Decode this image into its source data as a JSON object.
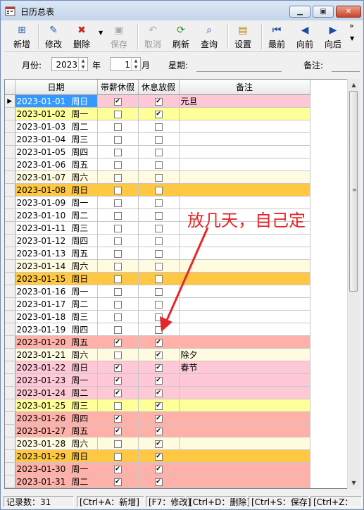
{
  "window": {
    "title": "日历总表"
  },
  "toolbar": [
    {
      "label": "新增",
      "icon": "add-icon",
      "enabled": true
    },
    {
      "label": "修改",
      "icon": "edit-icon",
      "enabled": true
    },
    {
      "label": "删除",
      "icon": "delete-icon",
      "enabled": true
    },
    {
      "label": "保存",
      "icon": "save-icon",
      "enabled": false
    },
    {
      "label": "取消",
      "icon": "undo-icon",
      "enabled": false
    },
    {
      "label": "刷新",
      "icon": "refresh-icon",
      "enabled": true
    },
    {
      "label": "查询",
      "icon": "search-icon",
      "enabled": true
    },
    {
      "label": "设置",
      "icon": "settings-icon",
      "enabled": true
    },
    {
      "label": "最前",
      "icon": "first-icon",
      "enabled": true
    },
    {
      "label": "向前",
      "icon": "prev-icon",
      "enabled": true
    },
    {
      "label": "向后",
      "icon": "next-icon",
      "enabled": true
    }
  ],
  "filter": {
    "month_label": "月份:",
    "year_value": "2023",
    "year_unit": "年",
    "month_value": "1",
    "month_unit": "月",
    "weekday_label": "星期:",
    "note_label": "备注:"
  },
  "grid": {
    "columns": [
      "日期",
      "带薪休假",
      "休息放假",
      "备注"
    ],
    "rows": [
      {
        "date": "2023-01-01",
        "weekday": "周日",
        "paid": true,
        "rest": true,
        "note": "元旦",
        "bg": "#ffc8d6",
        "selected": true
      },
      {
        "date": "2023-01-02",
        "weekday": "周一",
        "paid": false,
        "rest": true,
        "note": "",
        "bg": "#ffff99"
      },
      {
        "date": "2023-01-03",
        "weekday": "周二",
        "paid": false,
        "rest": false,
        "note": "",
        "bg": "#ffffff"
      },
      {
        "date": "2023-01-04",
        "weekday": "周三",
        "paid": false,
        "rest": false,
        "note": "",
        "bg": "#ffffff"
      },
      {
        "date": "2023-01-05",
        "weekday": "周四",
        "paid": false,
        "rest": false,
        "note": "",
        "bg": "#ffffff"
      },
      {
        "date": "2023-01-06",
        "weekday": "周五",
        "paid": false,
        "rest": false,
        "note": "",
        "bg": "#ffffff"
      },
      {
        "date": "2023-01-07",
        "weekday": "周六",
        "paid": false,
        "rest": false,
        "note": "",
        "bg": "#fffbe0"
      },
      {
        "date": "2023-01-08",
        "weekday": "周日",
        "paid": false,
        "rest": false,
        "note": "",
        "bg": "#ffc844"
      },
      {
        "date": "2023-01-09",
        "weekday": "周一",
        "paid": false,
        "rest": false,
        "note": "",
        "bg": "#ffffff"
      },
      {
        "date": "2023-01-10",
        "weekday": "周二",
        "paid": false,
        "rest": false,
        "note": "",
        "bg": "#ffffff"
      },
      {
        "date": "2023-01-11",
        "weekday": "周三",
        "paid": false,
        "rest": false,
        "note": "",
        "bg": "#ffffff"
      },
      {
        "date": "2023-01-12",
        "weekday": "周四",
        "paid": false,
        "rest": false,
        "note": "",
        "bg": "#ffffff"
      },
      {
        "date": "2023-01-13",
        "weekday": "周五",
        "paid": false,
        "rest": false,
        "note": "",
        "bg": "#ffffff"
      },
      {
        "date": "2023-01-14",
        "weekday": "周六",
        "paid": false,
        "rest": false,
        "note": "",
        "bg": "#fffbe0"
      },
      {
        "date": "2023-01-15",
        "weekday": "周日",
        "paid": false,
        "rest": false,
        "note": "",
        "bg": "#ffc844"
      },
      {
        "date": "2023-01-16",
        "weekday": "周一",
        "paid": false,
        "rest": false,
        "note": "",
        "bg": "#ffffff"
      },
      {
        "date": "2023-01-17",
        "weekday": "周二",
        "paid": false,
        "rest": false,
        "note": "",
        "bg": "#ffffff"
      },
      {
        "date": "2023-01-18",
        "weekday": "周三",
        "paid": false,
        "rest": false,
        "note": "",
        "bg": "#ffffff"
      },
      {
        "date": "2023-01-19",
        "weekday": "周四",
        "paid": false,
        "rest": false,
        "note": "",
        "bg": "#ffffff"
      },
      {
        "date": "2023-01-20",
        "weekday": "周五",
        "paid": true,
        "rest": true,
        "note": "",
        "bg": "#ffb0a8"
      },
      {
        "date": "2023-01-21",
        "weekday": "周六",
        "paid": false,
        "rest": true,
        "note": "除夕",
        "bg": "#fffbe0"
      },
      {
        "date": "2023-01-22",
        "weekday": "周日",
        "paid": true,
        "rest": true,
        "note": "春节",
        "bg": "#ffc8d6"
      },
      {
        "date": "2023-01-23",
        "weekday": "周一",
        "paid": true,
        "rest": true,
        "note": "",
        "bg": "#ffc8d6"
      },
      {
        "date": "2023-01-24",
        "weekday": "周二",
        "paid": true,
        "rest": true,
        "note": "",
        "bg": "#ffc8d6"
      },
      {
        "date": "2023-01-25",
        "weekday": "周三",
        "paid": false,
        "rest": true,
        "note": "",
        "bg": "#ffff99"
      },
      {
        "date": "2023-01-26",
        "weekday": "周四",
        "paid": true,
        "rest": true,
        "note": "",
        "bg": "#ffb0a8"
      },
      {
        "date": "2023-01-27",
        "weekday": "周五",
        "paid": true,
        "rest": true,
        "note": "",
        "bg": "#ffb0a8"
      },
      {
        "date": "2023-01-28",
        "weekday": "周六",
        "paid": false,
        "rest": true,
        "note": "",
        "bg": "#fffbe0"
      },
      {
        "date": "2023-01-29",
        "weekday": "周日",
        "paid": false,
        "rest": true,
        "note": "",
        "bg": "#ffc844"
      },
      {
        "date": "2023-01-30",
        "weekday": "周一",
        "paid": true,
        "rest": true,
        "note": "",
        "bg": "#ffb0a8"
      },
      {
        "date": "2023-01-31",
        "weekday": "周二",
        "paid": true,
        "rest": true,
        "note": "",
        "bg": "#ffb0a8"
      }
    ]
  },
  "status": {
    "record_count": "记录数：31",
    "hints": [
      "[Ctrl+A：新增]",
      "[F7：修改]",
      "[Ctrl+D：删除]",
      "[Ctrl+S：保存]",
      "[Ctrl+Z："
    ]
  },
  "annotation": {
    "text": "放几天，自己定",
    "color": "#e8262a"
  },
  "colors": {
    "selected_bg": "#3399ff",
    "grid_line": "#c7c7c7"
  }
}
